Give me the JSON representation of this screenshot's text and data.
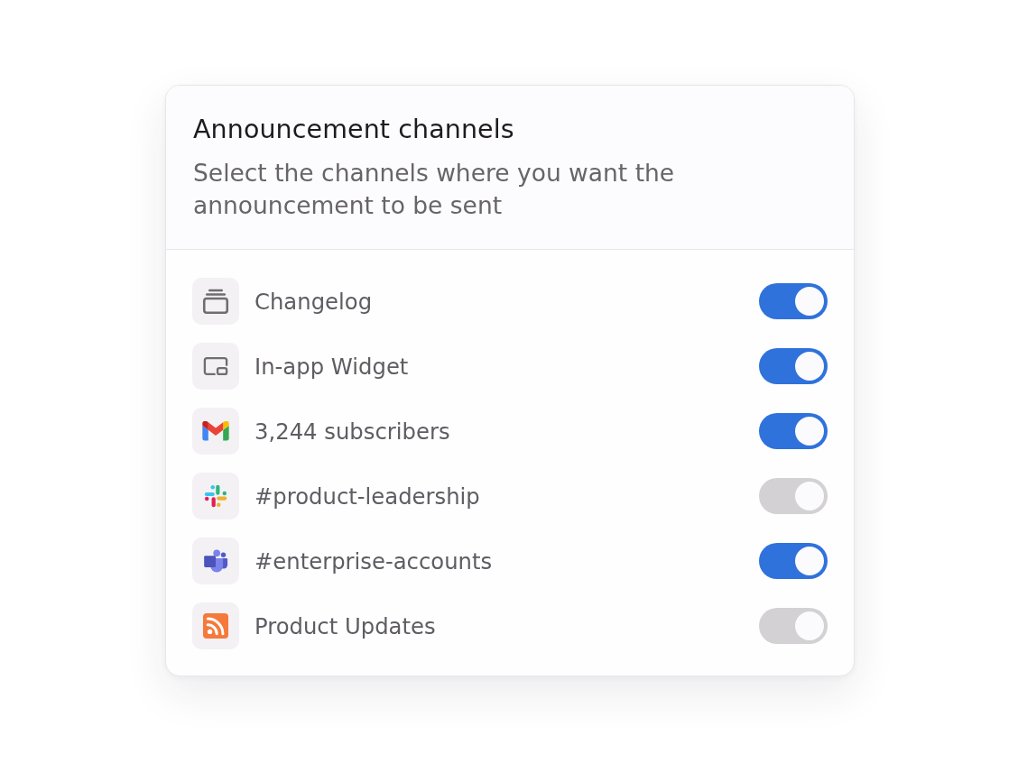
{
  "card": {
    "title": "Announcement channels",
    "description": "Select the channels where you want the announcement to be sent"
  },
  "channels": [
    {
      "kind": "changelog",
      "label": "Changelog",
      "on": true,
      "disabled": false
    },
    {
      "kind": "widget",
      "label": "In-app Widget",
      "on": true,
      "disabled": false
    },
    {
      "kind": "email",
      "label": "3,244 subscribers",
      "on": true,
      "disabled": false
    },
    {
      "kind": "chat",
      "label": "#product-leadership",
      "on": true,
      "disabled": true
    },
    {
      "kind": "team",
      "label": "#enterprise-accounts",
      "on": true,
      "disabled": false
    },
    {
      "kind": "feed",
      "label": "Product Updates",
      "on": true,
      "disabled": true
    }
  ]
}
